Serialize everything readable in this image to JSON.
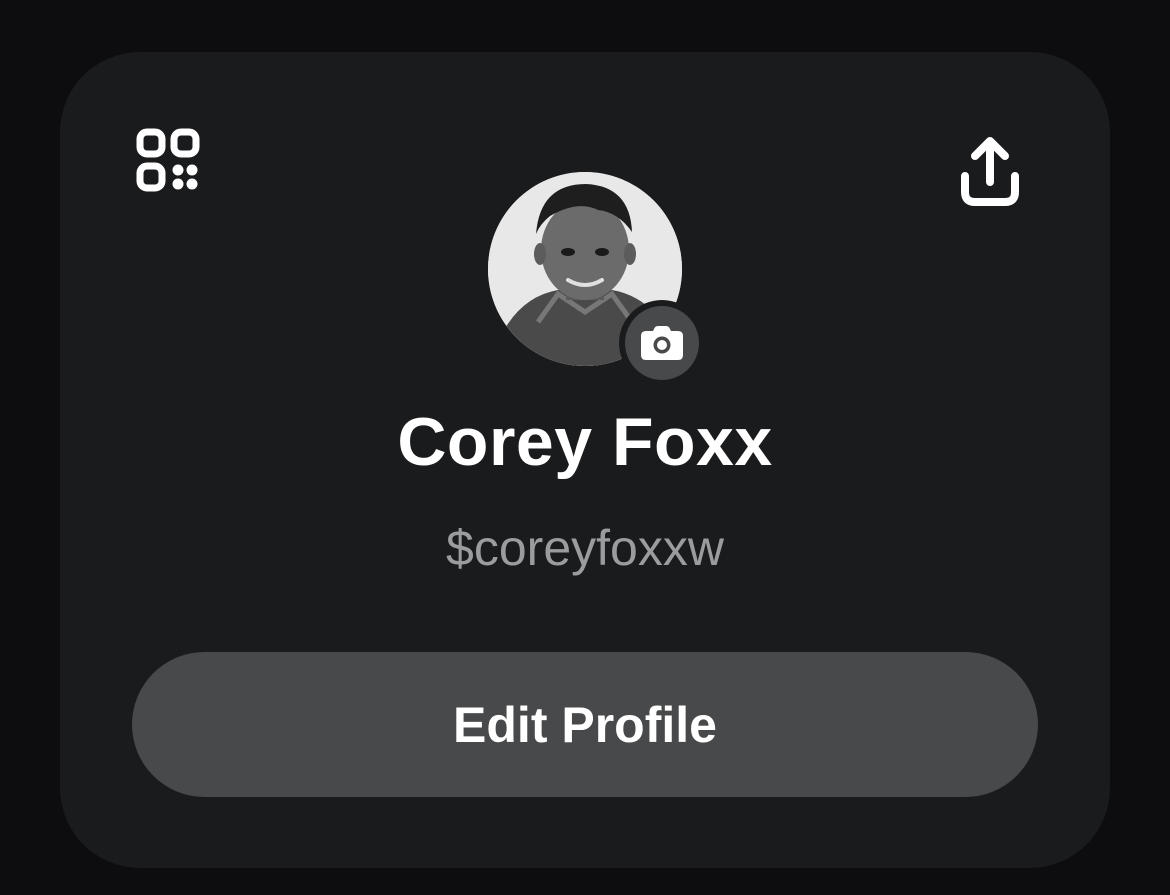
{
  "profile": {
    "name": "Corey Foxx",
    "cashtag": "$coreyfoxxw",
    "edit_label": "Edit Profile"
  },
  "icons": {
    "qr": "qr-code-icon",
    "share": "share-icon",
    "camera": "camera-icon"
  },
  "colors": {
    "background": "#0d0d0f",
    "card": "#1a1b1d",
    "button": "#48494b",
    "secondary_text": "#9b9c9e"
  }
}
